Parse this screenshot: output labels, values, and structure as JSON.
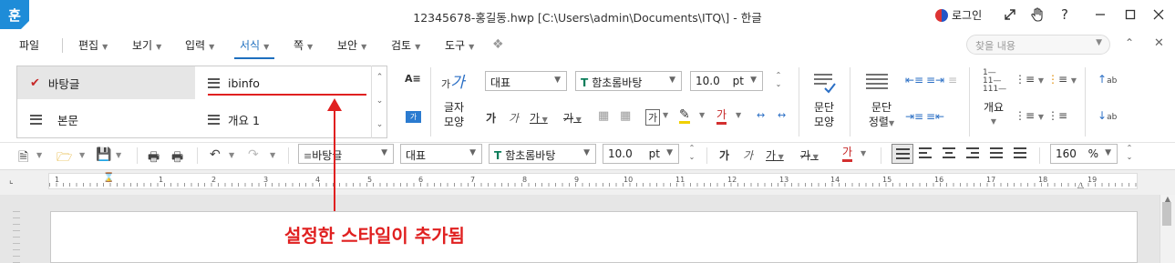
{
  "titlebar": {
    "app_icon_label": "훈",
    "title": "12345678-홍길동.hwp [C:\\Users\\admin\\Documents\\ITQ\\] - 한글",
    "login_label": "로그인",
    "icons": [
      "expand-icon",
      "hand-icon",
      "help-icon",
      "minimize-icon",
      "maximize-icon",
      "close-icon"
    ],
    "help_glyph": "?"
  },
  "menubar": {
    "items": [
      {
        "label": "파일"
      },
      {
        "label": "편집"
      },
      {
        "label": "보기"
      },
      {
        "label": "입력"
      },
      {
        "label": "서식"
      },
      {
        "label": "쪽"
      },
      {
        "label": "보안"
      },
      {
        "label": "검토"
      },
      {
        "label": "도구"
      }
    ],
    "active": "서식",
    "search_placeholder": "찾을 내용"
  },
  "style_list": {
    "items": [
      {
        "label": "바탕글",
        "selected": true
      },
      {
        "label": "ibinfo",
        "selected": false
      },
      {
        "label": "본문",
        "selected": false
      },
      {
        "label": "개요 1",
        "selected": false
      }
    ]
  },
  "ribbon": {
    "char_shape_label": "글자\n모양",
    "char_shape_line1": "글자",
    "char_shape_line2": "모양",
    "font_lang": "대표",
    "font_name": "함초롬바탕",
    "font_size": "10.0",
    "font_unit": "pt",
    "para_shape_line1": "문단",
    "para_shape_line2": "모양",
    "para_sort_line1": "문단",
    "para_sort_line2": "정렬",
    "outline_label": "개요",
    "bold_glyph": "가",
    "italic_glyph": "가",
    "underline_glyph": "가",
    "strike_glyph": "가",
    "char_glyph": "가",
    "color_glyph": "가",
    "highlight_glyph": "가",
    "charshape_small": "가",
    "charshape_big": "가"
  },
  "stdbar": {
    "style_value": "바탕글",
    "font_lang": "대표",
    "font_name": "함초롬바탕",
    "font_size": "10.0",
    "font_unit": "pt",
    "zoom": "160",
    "zoom_unit": "%",
    "bold_glyph": "가",
    "italic_glyph": "가",
    "underline_glyph": "가",
    "strike_glyph": "가",
    "color_glyph": "가"
  },
  "ruler": {
    "numbers": [
      "1",
      "1",
      "2",
      "3",
      "4",
      "5",
      "6",
      "7",
      "8",
      "9",
      "10",
      "11",
      "12",
      "13",
      "14",
      "15",
      "16",
      "17",
      "18",
      "19"
    ]
  },
  "annotation": {
    "text": "설정한 스타일이 추가됨",
    "color": "#e02020"
  },
  "colors": {
    "accent": "#1e6fbf",
    "app_icon": "#1e8cd8",
    "annotation": "#e02020"
  }
}
